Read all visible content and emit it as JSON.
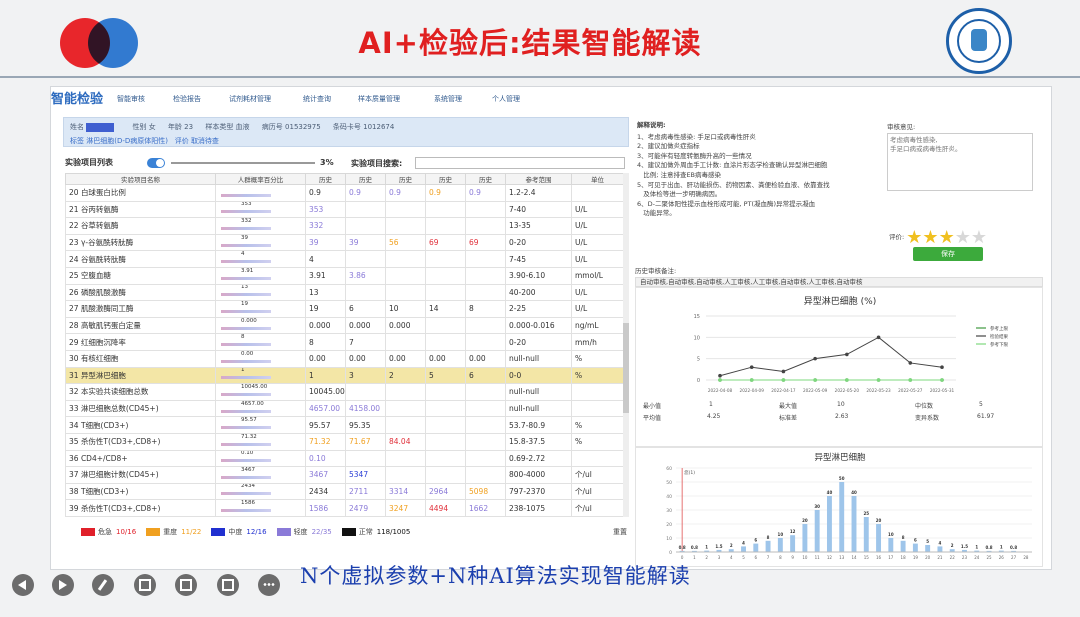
{
  "slide": {
    "headline": "AI+检验后:结果智能解读",
    "caption": "N个虚拟参数+N种AI算法实现智能解读"
  },
  "app": {
    "brand": "智能检验",
    "menu": [
      "智能审核",
      "检验报告",
      "试剂耗材管理",
      "统计查询",
      "样本质量管理",
      "系统管理",
      "个人管理"
    ],
    "info": {
      "name_label": "姓名",
      "sex_label": "性别",
      "sex": "女",
      "age_label": "年龄",
      "age": "23",
      "sample_type_label": "样本类型",
      "sample_type": "血液",
      "case_no_label": "病历号",
      "case_no": "01532975",
      "barcode_label": "条码卡号",
      "barcode": "1012674",
      "tag_label": "标签",
      "tag": "淋巴细胞(D-D病原体阳性)",
      "eval_label": "评价",
      "eval": "取消待查"
    },
    "list_title": "实验项目列表",
    "percent": "3%",
    "search_label": "实验项目搜索:",
    "columns": [
      "实验项目名称",
      "人群概率百分比",
      "历史",
      "历史",
      "历史",
      "历史",
      "历史",
      "参考范围",
      "单位"
    ],
    "rows": [
      {
        "no": "20",
        "name": "白球蛋白比例",
        "spark": "",
        "h1": "0.9",
        "h2": "0.9",
        "h3": "0.9",
        "h4": "0.9",
        "h5": "0.9",
        "ref": "1.2-2.4",
        "unit": "",
        "c": [
          "c-blk",
          "c-pur",
          "c-pur",
          "c-org",
          "c-pur"
        ]
      },
      {
        "no": "21",
        "name": "谷丙转氨酶",
        "spark": "353",
        "h1": "353",
        "h2": "",
        "h3": "",
        "h4": "",
        "h5": "",
        "ref": "7-40",
        "unit": "U/L",
        "c": [
          "c-pur",
          "",
          "",
          "",
          ""
        ]
      },
      {
        "no": "22",
        "name": "谷草转氨酶",
        "spark": "332",
        "h1": "332",
        "h2": "",
        "h3": "",
        "h4": "",
        "h5": "",
        "ref": "13-35",
        "unit": "U/L",
        "c": [
          "c-pur",
          "",
          "",
          "",
          ""
        ]
      },
      {
        "no": "23",
        "name": "γ-谷氨酰转肽酶",
        "spark": "39",
        "h1": "39",
        "h2": "39",
        "h3": "56",
        "h4": "69",
        "h5": "69",
        "ref": "0-20",
        "unit": "U/L",
        "c": [
          "c-pur",
          "c-pur",
          "c-org",
          "c-red",
          "c-red"
        ]
      },
      {
        "no": "24",
        "name": "谷氨酰转肽酶",
        "spark": "4",
        "h1": "4",
        "h2": "",
        "h3": "",
        "h4": "",
        "h5": "",
        "ref": "7-45",
        "unit": "U/L",
        "c": [
          "c-blk",
          "",
          "",
          "",
          ""
        ]
      },
      {
        "no": "25",
        "name": "空腹血糖",
        "spark": "3.91",
        "h1": "3.91",
        "h2": "3.86",
        "h3": "",
        "h4": "",
        "h5": "",
        "ref": "3.90-6.10",
        "unit": "mmol/L",
        "c": [
          "c-blk",
          "c-pur",
          "",
          "",
          ""
        ]
      },
      {
        "no": "26",
        "name": "磷酸肌酸激酶",
        "spark": "13",
        "h1": "13",
        "h2": "",
        "h3": "",
        "h4": "",
        "h5": "",
        "ref": "40-200",
        "unit": "U/L",
        "c": [
          "c-blk",
          "",
          "",
          "",
          ""
        ]
      },
      {
        "no": "27",
        "name": "肌酸激酶同工酶",
        "spark": "19",
        "h1": "19",
        "h2": "6",
        "h3": "10",
        "h4": "14",
        "h5": "8",
        "ref": "2-25",
        "unit": "U/L",
        "c": [
          "c-blk",
          "c-blk",
          "c-blk",
          "c-blk",
          "c-blk"
        ]
      },
      {
        "no": "28",
        "name": "高敏肌钙蛋白定量",
        "spark": "0.000",
        "h1": "0.000",
        "h2": "0.000",
        "h3": "0.000",
        "h4": "",
        "h5": "",
        "ref": "0.000-0.016",
        "unit": "ng/mL",
        "c": [
          "c-blk",
          "c-blk",
          "c-blk",
          "",
          ""
        ]
      },
      {
        "no": "29",
        "name": "红细胞沉降率",
        "spark": "8",
        "h1": "8",
        "h2": "7",
        "h3": "",
        "h4": "",
        "h5": "",
        "ref": "0-20",
        "unit": "mm/h",
        "c": [
          "c-blk",
          "c-blk",
          "",
          "",
          ""
        ]
      },
      {
        "no": "30",
        "name": "有核红细胞",
        "spark": "0.00",
        "h1": "0.00",
        "h2": "0.00",
        "h3": "0.00",
        "h4": "0.00",
        "h5": "0.00",
        "ref": "null-null",
        "unit": "%",
        "c": [
          "c-blk",
          "c-blk",
          "c-blk",
          "c-blk",
          "c-blk"
        ]
      },
      {
        "no": "31",
        "name": "异型淋巴细胞",
        "spark": "1",
        "h1": "1",
        "h2": "3",
        "h3": "2",
        "h4": "5",
        "h5": "6",
        "ref": "0-0",
        "unit": "%",
        "c": [
          "c-blk",
          "c-blk",
          "c-blk",
          "c-blk",
          "c-blk"
        ],
        "selected": true
      },
      {
        "no": "32",
        "name": "本实验共读细胞总数",
        "spark": "10045.00",
        "h1": "10045.00",
        "h2": "",
        "h3": "",
        "h4": "",
        "h5": "",
        "ref": "null-null",
        "unit": "",
        "c": [
          "c-blk",
          "",
          "",
          "",
          ""
        ]
      },
      {
        "no": "33",
        "name": "淋巴细胞总数(CD45+)",
        "spark": "4657.00",
        "h1": "4657.00",
        "h2": "4158.00",
        "h3": "",
        "h4": "",
        "h5": "",
        "ref": "null-null",
        "unit": "",
        "c": [
          "c-pur",
          "c-pur",
          "",
          "",
          ""
        ]
      },
      {
        "no": "34",
        "name": "T细胞(CD3+)",
        "spark": "95.57",
        "h1": "95.57",
        "h2": "95.35",
        "h3": "",
        "h4": "",
        "h5": "",
        "ref": "53.7-80.9",
        "unit": "%",
        "c": [
          "c-blk",
          "c-blk",
          "",
          "",
          ""
        ]
      },
      {
        "no": "35",
        "name": "杀伤性T(CD3+,CD8+)",
        "spark": "71.32",
        "h1": "71.32",
        "h2": "71.67",
        "h3": "84.04",
        "h4": "",
        "h5": "",
        "ref": "15.8-37.5",
        "unit": "%",
        "c": [
          "c-org",
          "c-org",
          "c-red",
          "",
          ""
        ]
      },
      {
        "no": "36",
        "name": "CD4+/CD8+",
        "spark": "0.10",
        "h1": "0.10",
        "h2": "",
        "h3": "",
        "h4": "",
        "h5": "",
        "ref": "0.69-2.72",
        "unit": "",
        "c": [
          "c-pur",
          "",
          "",
          "",
          ""
        ]
      },
      {
        "no": "37",
        "name": "淋巴细胞计数(CD45+)",
        "spark": "3467",
        "h1": "3467",
        "h2": "5347",
        "h3": "",
        "h4": "",
        "h5": "",
        "ref": "800-4000",
        "unit": "个/ul",
        "c": [
          "c-pur",
          "c-blu",
          "",
          "",
          ""
        ]
      },
      {
        "no": "38",
        "name": "T细胞(CD3+)",
        "spark": "2434",
        "h1": "2434",
        "h2": "2711",
        "h3": "3314",
        "h4": "2964",
        "h5": "5098",
        "ref": "797-2370",
        "unit": "个/ul",
        "c": [
          "c-blk",
          "c-pur",
          "c-pur",
          "c-pur",
          "c-org"
        ]
      },
      {
        "no": "39",
        "name": "杀伤性T(CD3+,CD8+)",
        "spark": "1586",
        "h1": "1586",
        "h2": "2479",
        "h3": "3247",
        "h4": "4494",
        "h5": "1662",
        "ref": "238-1075",
        "unit": "个/ul",
        "c": [
          "c-pur",
          "c-pur",
          "c-org",
          "c-red",
          "c-pur"
        ]
      }
    ],
    "legend": [
      {
        "label": "危急",
        "count": "10/16",
        "color": "#e0202a"
      },
      {
        "label": "重度",
        "count": "11/22",
        "color": "#f0a020"
      },
      {
        "label": "中度",
        "count": "12/16",
        "color": "#2030d0"
      },
      {
        "label": "轻度",
        "count": "22/35",
        "color": "#8a7ad8"
      },
      {
        "label": "正常",
        "count": "118/1005",
        "color": "#111111"
      }
    ],
    "reset_label": "重置",
    "advice": {
      "title": "解释说明:",
      "lines": [
        "1、考虑病毒性感染: 手足口或病毒性肝炎",
        "2、建议加做炎症指标",
        "3、可能伴有轻度转氨酶升高的一些情况",
        "4、建议加做外周血手工计数: 血涂片形态学检查确认异型淋巴细胞",
        "   比例; 注意排查EB病毒感染",
        "5、可见于出血、肝功能损伤、药物因素、粪便检验血液、依靠查找",
        "   及体检等进一步明确病因。",
        "6、D-二聚体阳性提示血栓形成可能, PT(凝血酶)异常提示凝血",
        "   功能异常。"
      ]
    },
    "opinion": {
      "title": "审核意见:",
      "text": "考虑病毒性感染,\n手足口病或病毒性肝炎。"
    },
    "rating_label": "评价:",
    "rating": 3,
    "rating_max": 5,
    "save_label": "保存",
    "history_title": "历史审核备注:",
    "history_text": "自动审核,自动审核,自动审核,人工审核,人工审核,自动审核,人工审核,自动审核"
  },
  "stats": {
    "min_label": "最小值",
    "min": "1",
    "max_label": "最大值",
    "max": "10",
    "median_label": "中位数",
    "median": "5",
    "mean_label": "平均值",
    "mean": "4.25",
    "sd_label": "标准差",
    "sd": "2.63",
    "cv_label": "变异系数",
    "cv": "61.97"
  },
  "chart_data": [
    {
      "type": "line",
      "title": "异型淋巴细胞 (%)",
      "x": [
        "2022-04-08",
        "2022-04-09",
        "2022-04-17",
        "2022-05-09",
        "2022-05-20",
        "2022-05-23",
        "2022-05-27",
        "2022-05-31"
      ],
      "series": [
        {
          "name": "参考上限",
          "values": [
            0,
            0,
            0,
            0,
            0,
            0,
            0,
            0
          ],
          "color": "#3e9a3e"
        },
        {
          "name": "检验结果",
          "values": [
            1,
            3,
            2,
            5,
            6,
            10,
            4,
            3
          ],
          "color": "#444444"
        },
        {
          "name": "参考下限",
          "values": [
            0,
            0,
            0,
            0,
            0,
            0,
            0,
            0
          ],
          "color": "#7ed87e"
        }
      ],
      "ylim": [
        0,
        15
      ],
      "yticks": [
        "0",
        "5",
        "10",
        "15"
      ],
      "grid": true,
      "legend": "right"
    },
    {
      "type": "bar",
      "title": "异型淋巴细胞",
      "categories": [
        "0",
        "1",
        "2",
        "3",
        "4",
        "5",
        "6",
        "7",
        "8",
        "9",
        "10",
        "11",
        "12",
        "13",
        "14",
        "15",
        "16",
        "17",
        "18",
        "19",
        "20",
        "21",
        "22",
        "23",
        "24",
        "25",
        "26",
        "27",
        "28"
      ],
      "values": [
        0.8,
        0.8,
        1,
        1.5,
        2,
        4,
        6,
        8,
        10,
        12,
        20,
        30,
        40,
        50,
        40,
        25,
        20,
        10,
        8,
        6,
        5,
        4,
        2,
        1.5,
        1,
        0.8,
        1,
        0.8,
        0
      ],
      "data_labels": [
        "0.8",
        "0.8",
        "1",
        "1.5",
        "2",
        "4",
        "6",
        "8",
        "10",
        "12",
        "20",
        "30",
        "40",
        "50",
        "40",
        "25",
        "20",
        "10",
        "8",
        "6",
        "5",
        "4",
        "2",
        "1.5",
        "1",
        "0.8",
        "1",
        "0.8",
        ""
      ],
      "ylim": [
        0,
        60
      ],
      "yticks": [
        "0",
        "10",
        "20",
        "30",
        "40",
        "50",
        "60"
      ],
      "marker_label": "您(1)",
      "color": "#9ec5ea"
    }
  ]
}
